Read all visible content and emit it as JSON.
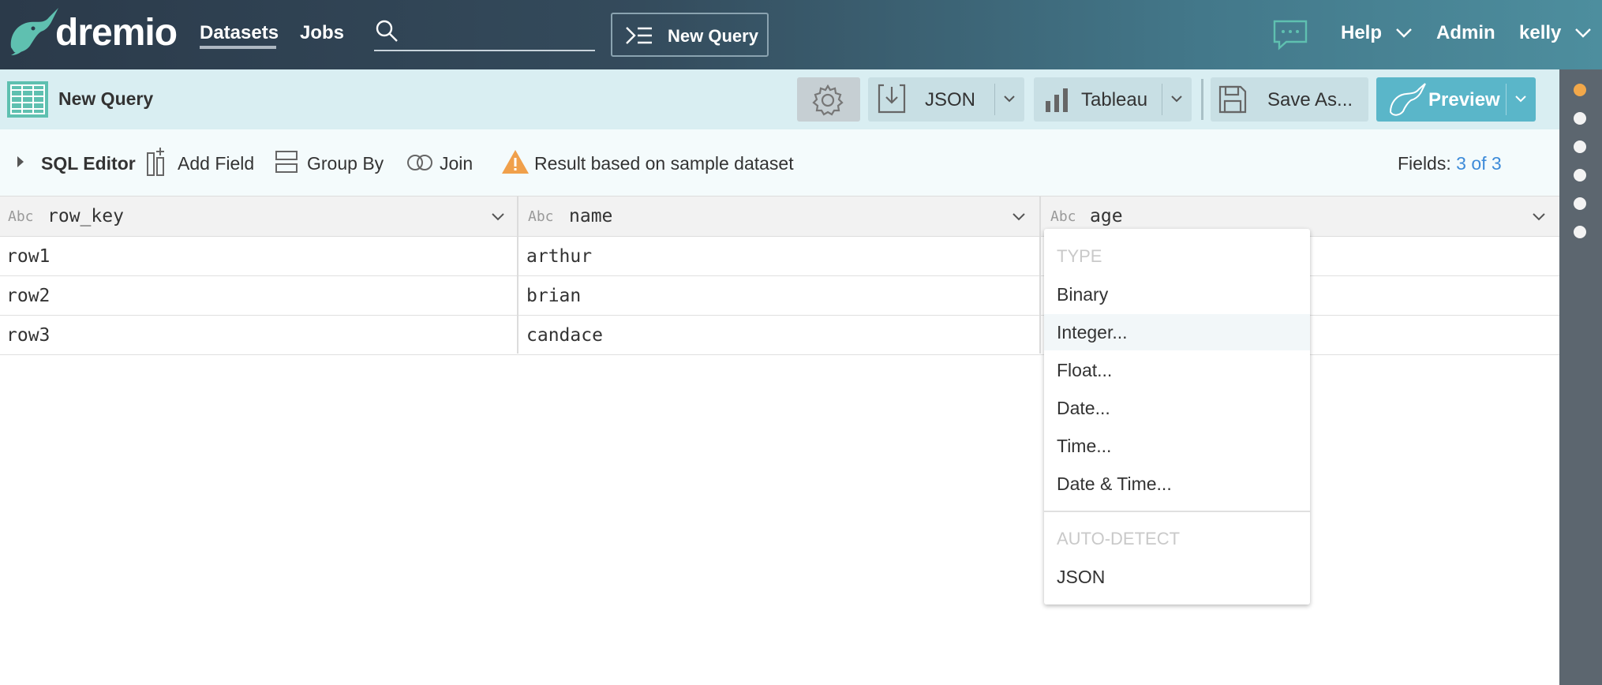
{
  "nav": {
    "logo": "dremio",
    "datasets": "Datasets",
    "jobs": "Jobs",
    "new_query": "New Query",
    "help": "Help",
    "admin": "Admin",
    "user": "kelly"
  },
  "toolbar": {
    "title": "New Query",
    "json": "JSON",
    "tableau": "Tableau",
    "save_as": "Save As...",
    "preview": "Preview"
  },
  "subtoolbar": {
    "sql_editor": "SQL Editor",
    "add_field": "Add Field",
    "group_by": "Group By",
    "join": "Join",
    "sample_warning": "Result based on sample dataset",
    "fields_label": "Fields:",
    "fields_count": "3 of 3"
  },
  "grid": {
    "columns": [
      {
        "type": "Abc",
        "name": "row_key"
      },
      {
        "type": "Abc",
        "name": "name"
      },
      {
        "type": "Abc",
        "name": "age"
      }
    ],
    "rows": [
      [
        "row1",
        "arthur"
      ],
      [
        "row2",
        "brian"
      ],
      [
        "row3",
        "candace"
      ]
    ]
  },
  "type_menu": {
    "type_header": "TYPE",
    "items": [
      "Binary",
      "Integer...",
      "Float...",
      "Date...",
      "Time...",
      "Date & Time..."
    ],
    "auto_header": "AUTO-DETECT",
    "auto_items": [
      "JSON"
    ]
  },
  "colors": {
    "accent": "#5ab6c9",
    "link": "#3d8bd9",
    "warning": "#f0a04b",
    "brand_teal": "#5fc0b0"
  }
}
